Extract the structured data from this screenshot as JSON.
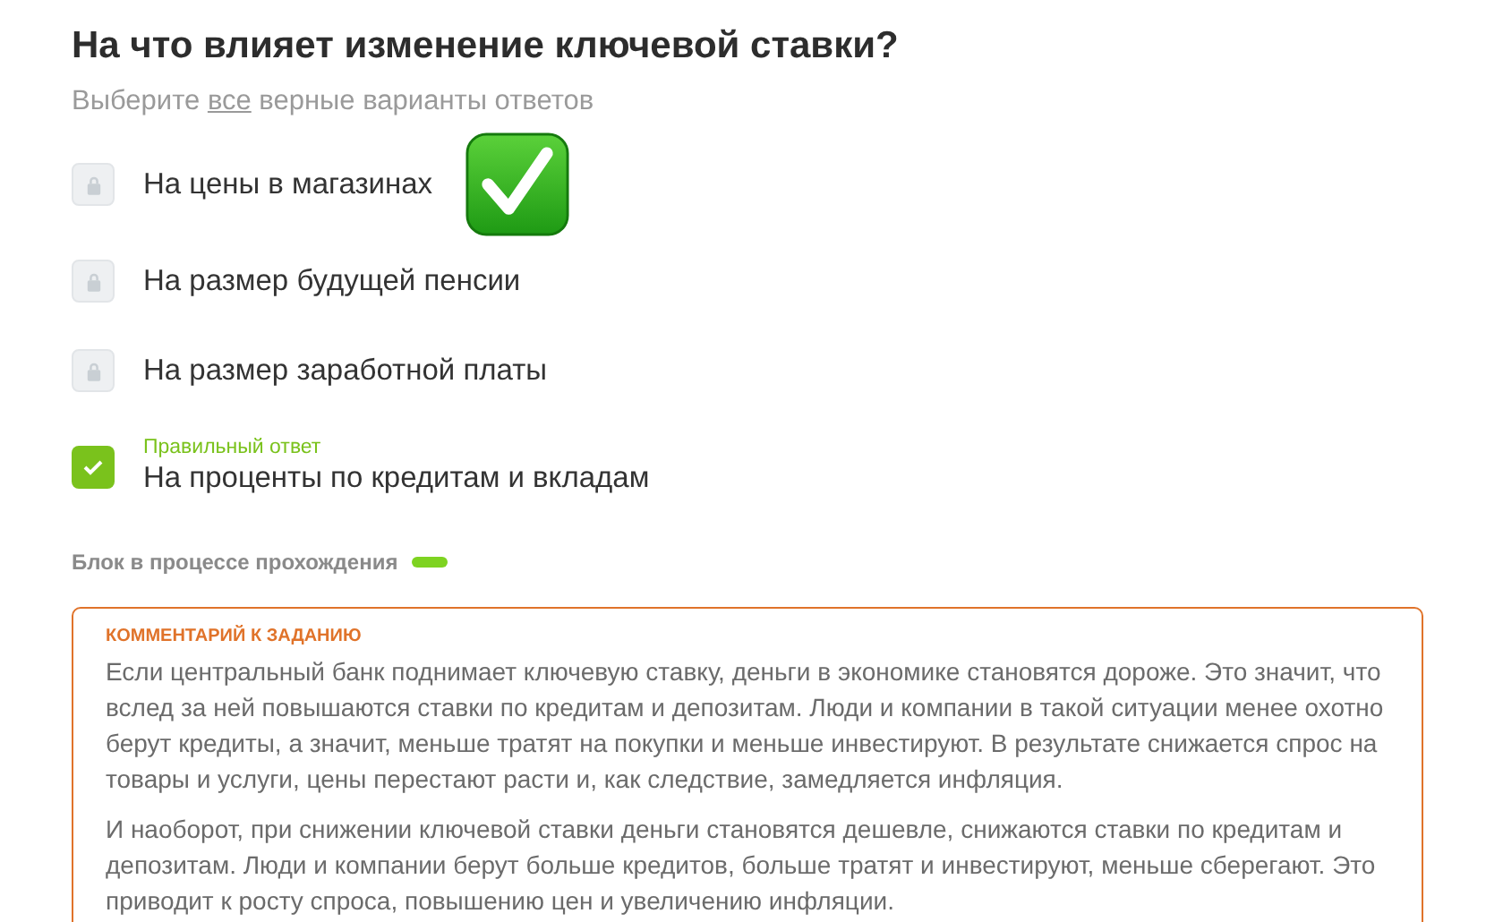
{
  "question": {
    "title": "На что влияет изменение ключевой ставки?",
    "instruction": {
      "before": "Выберите ",
      "underlined": "все",
      "after": " верные варианты ответов"
    }
  },
  "options": [
    {
      "kind": "locked",
      "label": "На цены в магазинах",
      "stamped": true
    },
    {
      "kind": "locked",
      "label": "На размер будущей пенсии",
      "stamped": false
    },
    {
      "kind": "locked",
      "label": "На размер заработной платы",
      "stamped": false
    },
    {
      "kind": "correct",
      "label": "На проценты по кредитам и вкладам",
      "note": "Правильный ответ",
      "stamped": false
    }
  ],
  "status": {
    "label": "Блок в процессе прохождения",
    "color": "#7ed321"
  },
  "comment": {
    "heading": "КОММЕНТАРИЙ К ЗАДАНИЮ",
    "paragraphs": [
      "Если центральный банк поднимает ключевую ставку, деньги в экономике становятся дороже. Это значит, что вслед за ней повышаются ставки по кредитам и депозитам. Люди и компании в такой ситуации менее охотно берут кредиты, а значит, меньше тратят на покупки и меньше инвестируют. В результате снижается спрос на товары и услуги, цены перестают расти и, как следствие, замедляется инфляция.",
      "И наоборот, при снижении ключевой ставки деньги становятся дешевле, снижаются ставки по кредитам и депозитам. Люди и компании берут больше кредитов, больше тратят и инвестируют, меньше сберегают. Это приводит к росту спроса, повышению цен и увеличению инфляции."
    ]
  }
}
